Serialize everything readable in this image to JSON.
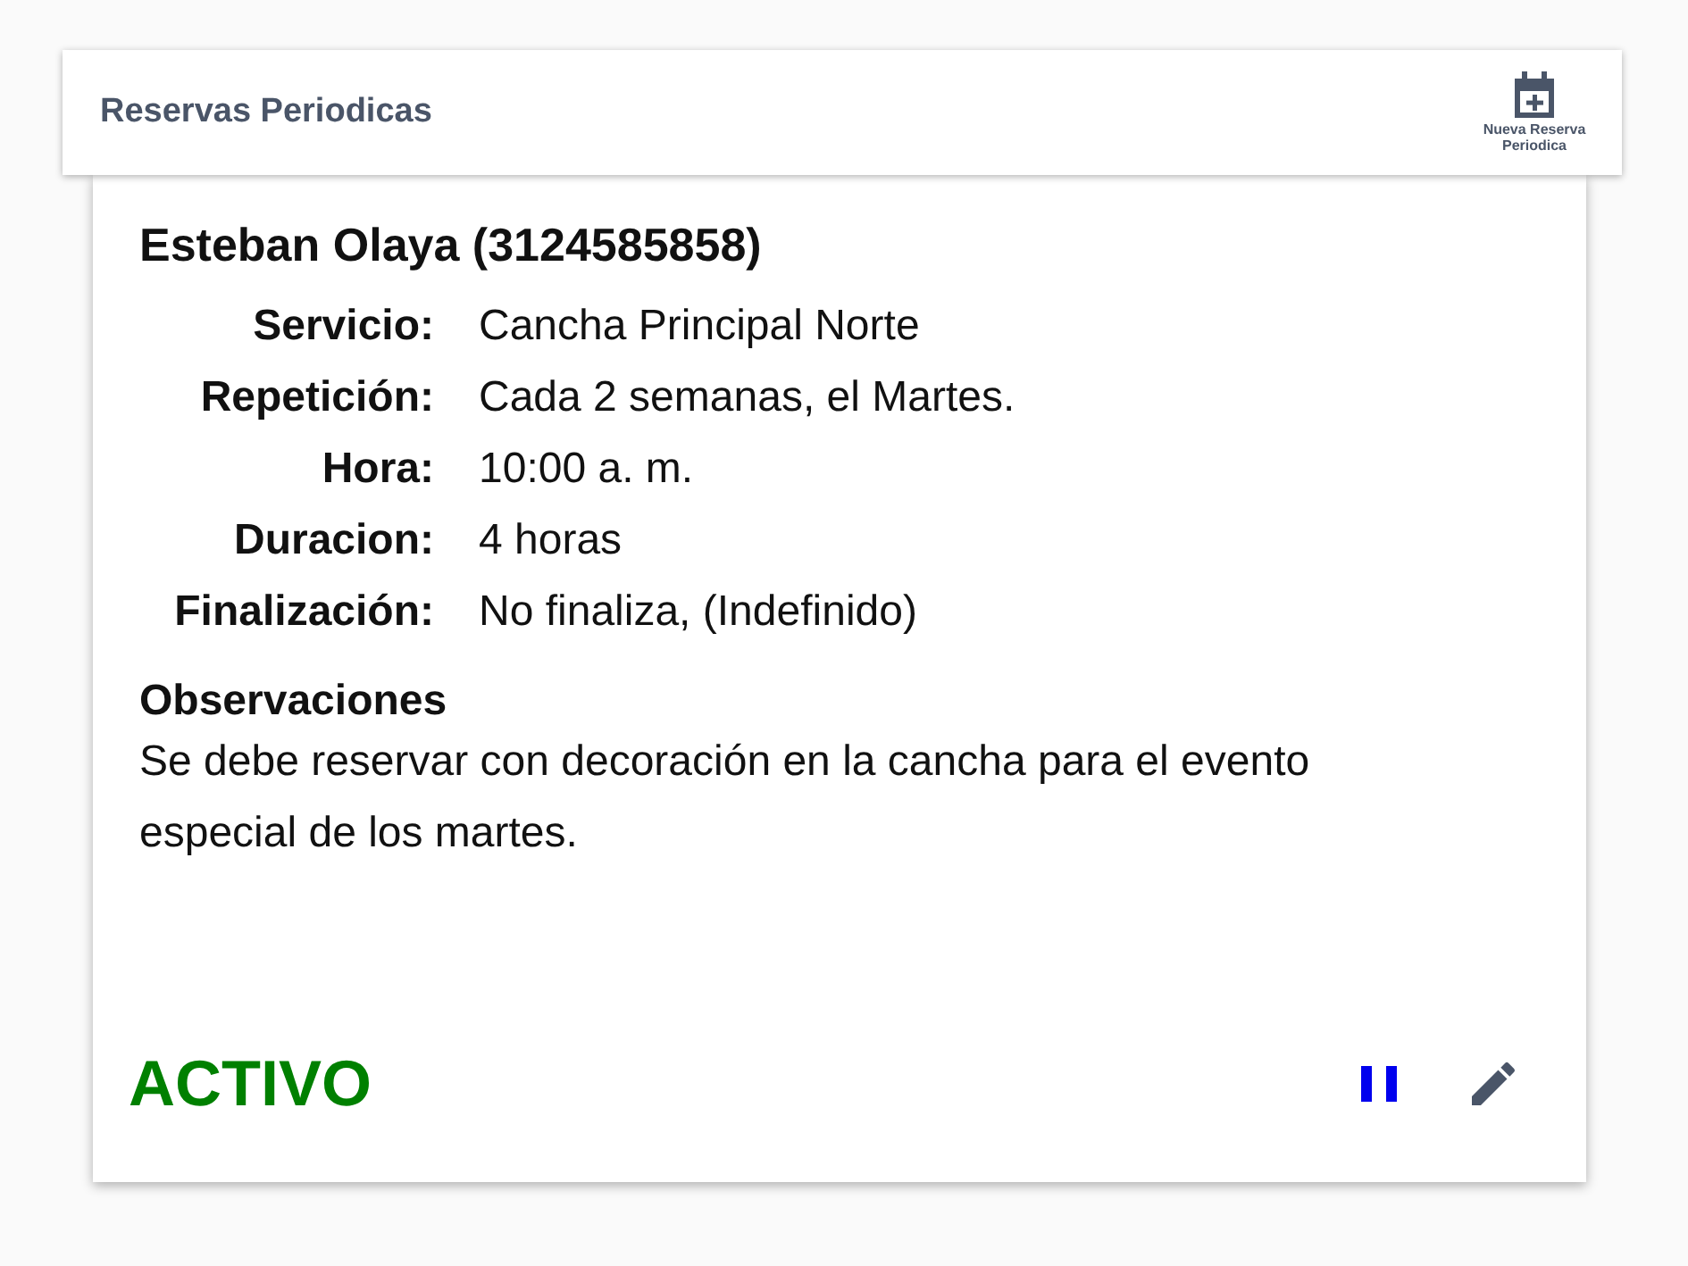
{
  "header": {
    "title": "Reservas Periodicas",
    "new_button": "Nueva Reserva Periodica"
  },
  "card": {
    "client": "Esteban Olaya (3124585858)",
    "fields": [
      {
        "label": "Servicio:",
        "value": "Cancha Principal Norte"
      },
      {
        "label": "Repetición:",
        "value": "Cada 2 semanas, el Martes."
      },
      {
        "label": "Hora:",
        "value": "10:00 a. m."
      },
      {
        "label": "Duracion:",
        "value": "4 horas"
      },
      {
        "label": "Finalización:",
        "value": "No finaliza, (Indefinido)"
      }
    ],
    "notes_title": "Observaciones",
    "notes": "Se debe reservar con decoración en la cancha para el evento especial de los martes.",
    "status": {
      "label": "ACTIVO",
      "active": true
    }
  }
}
